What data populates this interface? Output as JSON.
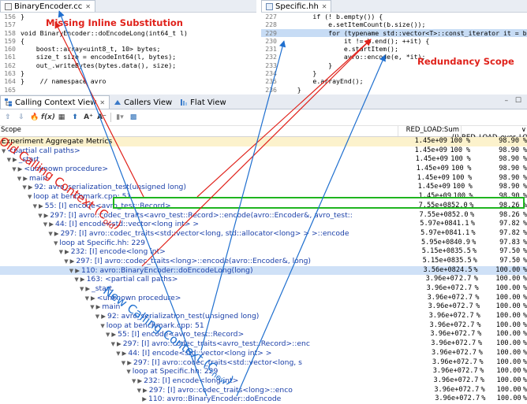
{
  "editor_left": {
    "filename": "BinaryEncoder.cc",
    "lines": [
      {
        "num": "156",
        "text": "}"
      },
      {
        "num": "157",
        "text": ""
      },
      {
        "num": "158",
        "text": "void BinaryEncoder::doEncodeLong(int64_t l)"
      },
      {
        "num": "159",
        "text": "{"
      },
      {
        "num": "160",
        "text": "    boost::array<uint8_t, 10> bytes;"
      },
      {
        "num": "161",
        "text": "    size_t size = encodeInt64(l, bytes);"
      },
      {
        "num": "162",
        "text": "    out_.writeBytes(bytes.data(), size);"
      },
      {
        "num": "163",
        "text": "}"
      },
      {
        "num": "164",
        "text": "}    // namespace avro"
      },
      {
        "num": "165",
        "text": ""
      }
    ],
    "annotation": "Missing Inline Substitution"
  },
  "editor_right": {
    "filename": "Specific.hh",
    "lines": [
      {
        "num": "227",
        "text": "        if (! b.empty()) {"
      },
      {
        "num": "228",
        "text": "            e.setItemCount(b.size());"
      },
      {
        "num": "229",
        "text": "            for (typename std::vector<T>::const_iterator it = b.beg"
      },
      {
        "num": "230",
        "text": "                it != b.end(); ++it) {"
      },
      {
        "num": "231",
        "text": "                e.startItem();"
      },
      {
        "num": "232",
        "text": "                avro::encode(e, *it);"
      },
      {
        "num": "233",
        "text": "            }"
      },
      {
        "num": "234",
        "text": "        }"
      },
      {
        "num": "235",
        "text": "        e.arrayEnd();"
      },
      {
        "num": "236",
        "text": "    }"
      }
    ],
    "highlight_line": "229",
    "annotation": "Redundancy Scope"
  },
  "view": {
    "tabs": [
      "Calling Context View",
      "Callers View",
      "Flat View"
    ],
    "window_controls": "– ☐",
    "columns": {
      "scope": "Scope",
      "metric1": "RED_LOAD:Sum (I)",
      "sort": "∨",
      "metric2": "RED_LOAD_over_LOAD"
    },
    "rows": [
      {
        "indent": 0,
        "arrow": "",
        "icon": "",
        "label": "Experiment Aggregate Metrics",
        "v1": "1.45e+09",
        "p1": "100",
        "v2": "98.90"
      },
      {
        "indent": 0,
        "arrow": "▼",
        "icon": "",
        "label": "<partial call paths>",
        "v1": "1.45e+09",
        "p1": "100",
        "v2": "98.90"
      },
      {
        "indent": 1,
        "arrow": "▼",
        "icon": "▶",
        "label": "_start",
        "v1": "1.45e+09",
        "p1": "100",
        "v2": "98.90"
      },
      {
        "indent": 2,
        "arrow": "▼",
        "icon": "▶",
        "label": "<unknown procedure>",
        "v1": "1.45e+09",
        "p1": "100",
        "v2": "98.90"
      },
      {
        "indent": 3,
        "arrow": "▼",
        "icon": "▶",
        "label": "main",
        "v1": "1.45e+09",
        "p1": "100",
        "v2": "98.90"
      },
      {
        "indent": 4,
        "arrow": "▼",
        "icon": "▶",
        "label": "92: avro_serialization_test(unsigned long)",
        "v1": "1.45e+09",
        "p1": "100",
        "v2": "98.90"
      },
      {
        "indent": 5,
        "arrow": "▼",
        "icon": "",
        "label": "loop at benchmark.cpp: 51",
        "v1": "1.45e+09",
        "p1": "100",
        "v2": "98.90"
      },
      {
        "indent": 6,
        "arrow": "▼",
        "icon": "▶",
        "label": "55: [I] encode<avro_test::Record>",
        "v1": "7.55e+08",
        "p1": "52.0",
        "v2": "98.26"
      },
      {
        "indent": 7,
        "arrow": "▼",
        "icon": "▶",
        "label": "297: [I] avro::codec_traits<avro_test::Record>::encode(avro::Encoder&, avro_test::",
        "v1": "7.55e+08",
        "p1": "52.0",
        "v2": "98.26"
      },
      {
        "indent": 8,
        "arrow": "▼",
        "icon": "▶",
        "label": "44: [I] encode<std::vector<long int> >",
        "v1": "5.97e+08",
        "p1": "41.1",
        "v2": "97.82"
      },
      {
        "indent": 9,
        "arrow": "▼",
        "icon": "▶",
        "label": "297: [I] avro::codec_traits<std::vector<long, std::allocator<long> > >::encode",
        "v1": "5.97e+08",
        "p1": "41.1",
        "v2": "97.82"
      },
      {
        "indent": 10,
        "arrow": "▼",
        "icon": "",
        "label": "loop at Specific.hh: 229",
        "v1": "5.95e+08",
        "p1": "40.9",
        "v2": "97.83"
      },
      {
        "indent": 11,
        "arrow": "▼",
        "icon": "▶",
        "label": "232: [I] encode<long int>",
        "v1": "5.15e+08",
        "p1": "35.5",
        "v2": "97.50"
      },
      {
        "indent": 12,
        "arrow": "▼",
        "icon": "▶",
        "label": "297: [I] avro::codec_traits<long>::encode(avro::Encoder&, long)",
        "v1": "5.15e+08",
        "p1": "35.5",
        "v2": "97.50"
      },
      {
        "indent": 13,
        "arrow": "▼",
        "icon": "▶",
        "label": "110: avro::BinaryEncoder::doEncodeLong(long)",
        "v1": "3.56e+08",
        "p1": "24.5",
        "v2": "100.00",
        "selected": true
      },
      {
        "indent": 14,
        "arrow": "▼",
        "icon": "▶",
        "label": "163: <partial call paths>",
        "v1": "3.96e+07",
        "p1": "2.7",
        "v2": "100.00"
      },
      {
        "indent": 15,
        "arrow": "▼",
        "icon": "▶",
        "label": "_start",
        "v1": "3.96e+07",
        "p1": "2.7",
        "v2": "100.00"
      },
      {
        "indent": 16,
        "arrow": "▼",
        "icon": "▶",
        "label": "<unknown procedure>",
        "v1": "3.96e+07",
        "p1": "2.7",
        "v2": "100.00"
      },
      {
        "indent": 17,
        "arrow": "▼",
        "icon": "▶",
        "label": "main",
        "v1": "3.96e+07",
        "p1": "2.7",
        "v2": "100.00"
      },
      {
        "indent": 18,
        "arrow": "▼",
        "icon": "▶",
        "label": "92: avro_serialization_test(unsigned long)",
        "v1": "3.96e+07",
        "p1": "2.7",
        "v2": "100.00"
      },
      {
        "indent": 19,
        "arrow": "▼",
        "icon": "",
        "label": "loop at benchmark.cpp: 51",
        "v1": "3.96e+07",
        "p1": "2.7",
        "v2": "100.00"
      },
      {
        "indent": 20,
        "arrow": "▼",
        "icon": "▶",
        "label": "55: [I] encode<avro_test::Record>",
        "v1": "3.96e+07",
        "p1": "2.7",
        "v2": "100.00"
      },
      {
        "indent": 21,
        "arrow": "▼",
        "icon": "▶",
        "label": "297: [I] avro::codec_traits<avro_test::Record>::enc",
        "v1": "3.96e+07",
        "p1": "2.7",
        "v2": "100.00"
      },
      {
        "indent": 22,
        "arrow": "▼",
        "icon": "▶",
        "label": "44: [I] encode<std::vector<long int> >",
        "v1": "3.96e+07",
        "p1": "2.7",
        "v2": "100.00"
      },
      {
        "indent": 23,
        "arrow": "▼",
        "icon": "▶",
        "label": "297: [I] avro::codec_traits<std::vector<long, s",
        "v1": "3.96e+07",
        "p1": "2.7",
        "v2": "100.00"
      },
      {
        "indent": 24,
        "arrow": "▼",
        "icon": "",
        "label": "loop at Specific.hh: 229",
        "v1": "3.96e+07",
        "p1": "2.7",
        "v2": "100.00"
      },
      {
        "indent": 25,
        "arrow": "▼",
        "icon": "▶",
        "label": "232: [I] encode<long int>",
        "v1": "3.96e+07",
        "p1": "2.7",
        "v2": "100.00"
      },
      {
        "indent": 26,
        "arrow": "▼",
        "icon": "▶",
        "label": "297: [I] avro::codec_traits<long>::enco",
        "v1": "3.96e+07",
        "p1": "2.7",
        "v2": "100.00"
      },
      {
        "indent": 27,
        "arrow": "",
        "icon": "▶",
        "label": "110: avro::BinaryEncoder::doEncode",
        "v1": "3.96e+07",
        "p1": "2.7",
        "v2": "100.00"
      }
    ]
  },
  "overlay": {
    "old_label": "Old Calling Context (C",
    "old_sub": "old",
    "new_label": "New Calling Context (C",
    "new_sub": "new",
    "colors": {
      "red": "#e0221b",
      "blue": "#1f6fcf",
      "green": "#1fb51f"
    }
  }
}
